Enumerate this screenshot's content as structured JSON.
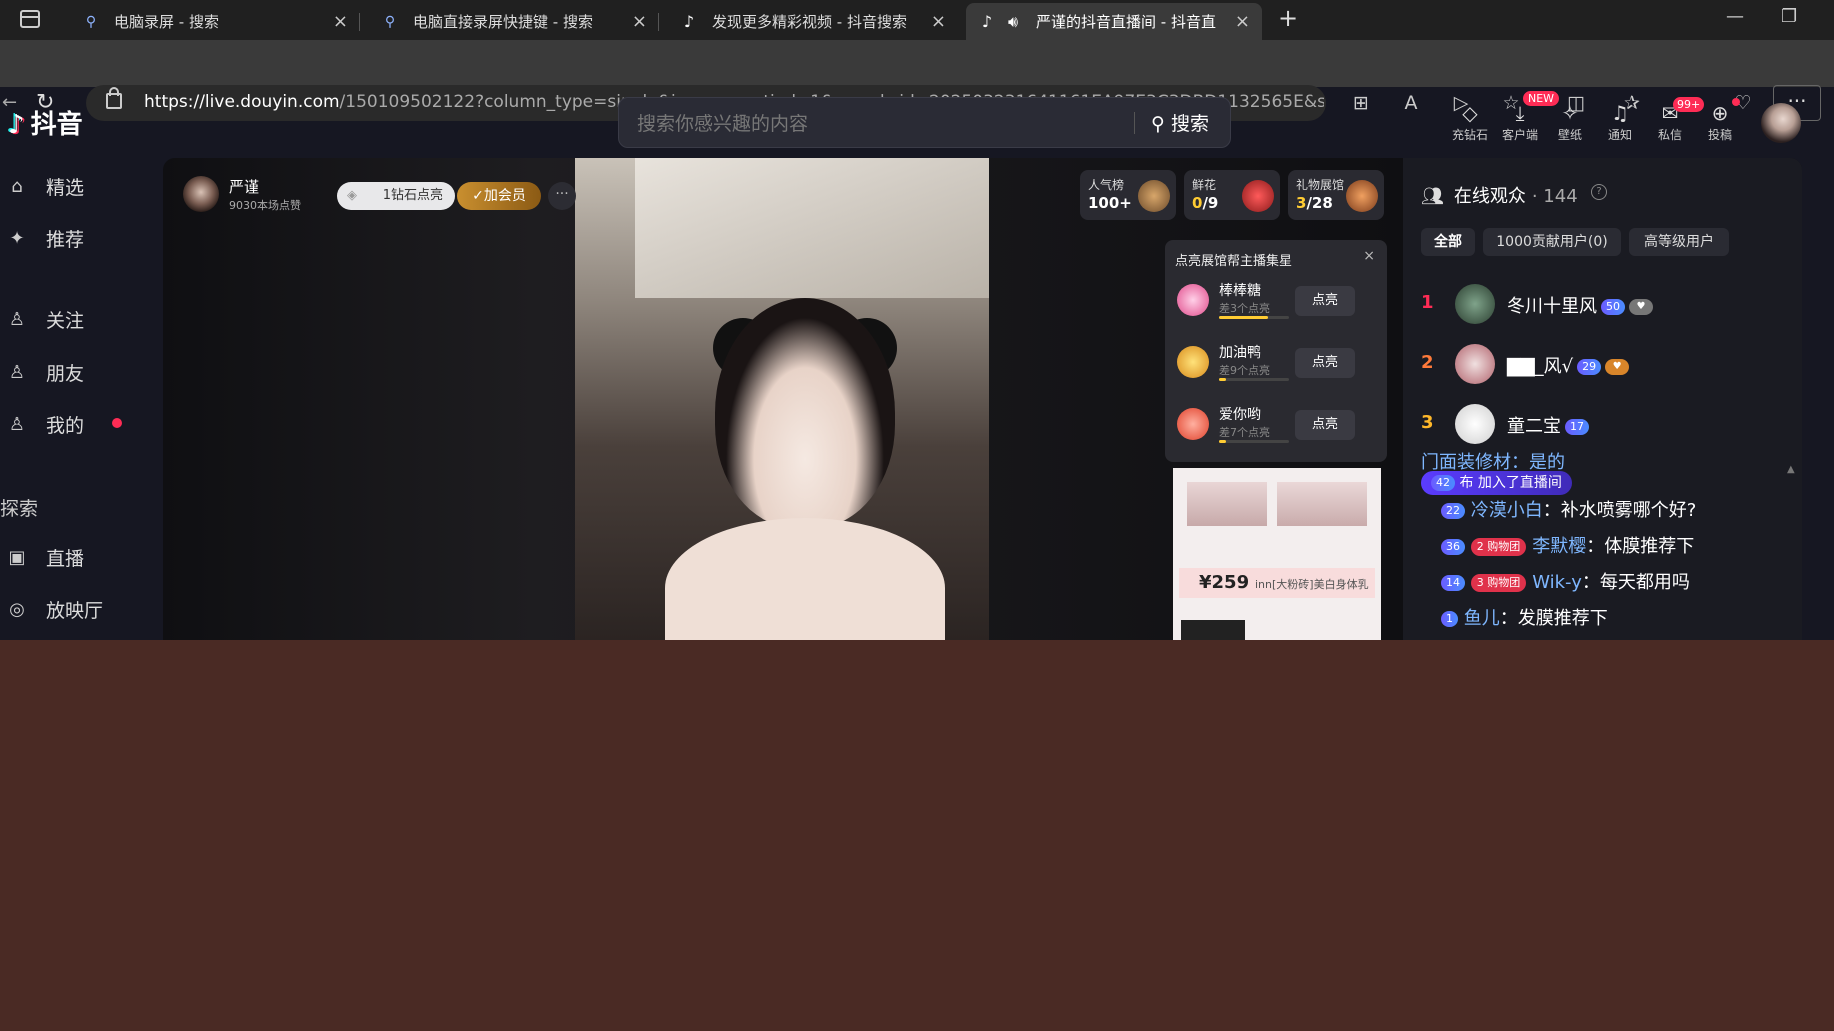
{
  "browser": {
    "tabs": [
      {
        "title": "电脑录屏 - 搜索"
      },
      {
        "title": "电脑直接录屏快捷键 - 搜索"
      },
      {
        "title": "发现更多精彩视频 - 抖音搜索"
      },
      {
        "title": "严谨的抖音直播间 - 抖音直"
      }
    ],
    "url_domain": "https://live.douyin.com",
    "url_path": "/150109502122?column_type=single&is_aweme_tied=1&search_id=202503231641161EA97E3C3DBD1132565E&search_result_id..."
  },
  "header": {
    "logo_text": "抖音",
    "search_placeholder": "搜索你感兴趣的内容",
    "search_button": "搜索",
    "items": [
      {
        "label": "充钻石",
        "icon": "diamond-icon"
      },
      {
        "label": "客户端",
        "icon": "download-icon"
      },
      {
        "label": "壁纸",
        "icon": "wallpaper-icon"
      },
      {
        "label": "通知",
        "icon": "bell-icon"
      },
      {
        "label": "私信",
        "icon": "message-icon"
      },
      {
        "label": "投稿",
        "icon": "upload-icon"
      }
    ],
    "badge_new": "NEW",
    "badge_messages": "99+"
  },
  "sidebar": {
    "items": [
      {
        "label": "精选"
      },
      {
        "label": "推荐"
      },
      {
        "label": "关注"
      },
      {
        "label": "朋友"
      },
      {
        "label": "我的"
      }
    ],
    "section": "探索",
    "explore_items": [
      {
        "label": "直播"
      },
      {
        "label": "放映厅"
      }
    ]
  },
  "live": {
    "host_name": "严谨",
    "host_likes": "9030本场点赞",
    "diamond_button": "1钻石点亮",
    "member_button": "加会员",
    "more": "···",
    "stats": [
      {
        "label": "人气榜",
        "value": "100+"
      },
      {
        "label": "鲜花",
        "value_hl": "0",
        "value_rest": "/9"
      },
      {
        "label": "礼物展馆",
        "value_hl": "3",
        "value_rest": "/28"
      }
    ],
    "gift_panel": {
      "title": "点亮展馆帮主播集星",
      "close": "×",
      "items": [
        {
          "name": "棒棒糖",
          "sub": "差3个点亮",
          "button": "点亮",
          "progress": 0.7
        },
        {
          "name": "加油鸭",
          "sub": "差9个点亮",
          "button": "点亮",
          "progress": 0.1
        },
        {
          "name": "爱你哟",
          "sub": "差7个点亮",
          "button": "点亮",
          "progress": 0.1
        }
      ]
    },
    "product": {
      "price": "¥259",
      "desc": "inn[大粉砖]美白身体乳"
    }
  },
  "audience": {
    "title": "在线观众",
    "count": "· 144",
    "tabs": [
      "全部",
      "1000贡献用户(0)",
      "高等级用户"
    ],
    "ranks": [
      {
        "num": "1",
        "name": "冬川十里风",
        "level": "50"
      },
      {
        "num": "2",
        "name": "▇▇_风√",
        "level": "29"
      },
      {
        "num": "3",
        "name": "童二宝",
        "level": "17"
      }
    ],
    "join_notice": {
      "level": "42",
      "name": "布",
      "text": "加入了直播间"
    },
    "chat_top_partial": "门面装修材：是的",
    "chat": [
      {
        "level": "22",
        "fan": "",
        "user": "冷漠小白",
        "text": "：补水喷雾哪个好?"
      },
      {
        "level": "36",
        "fan": "2 购物团",
        "user": "李默樱",
        "text": "：体膜推荐下"
      },
      {
        "level": "14",
        "fan": "3 购物团",
        "user": "Wik-y",
        "text": "：每天都用吗"
      },
      {
        "level": "1",
        "fan": "",
        "user": "鱼儿",
        "text": "：发膜推荐下"
      }
    ]
  }
}
